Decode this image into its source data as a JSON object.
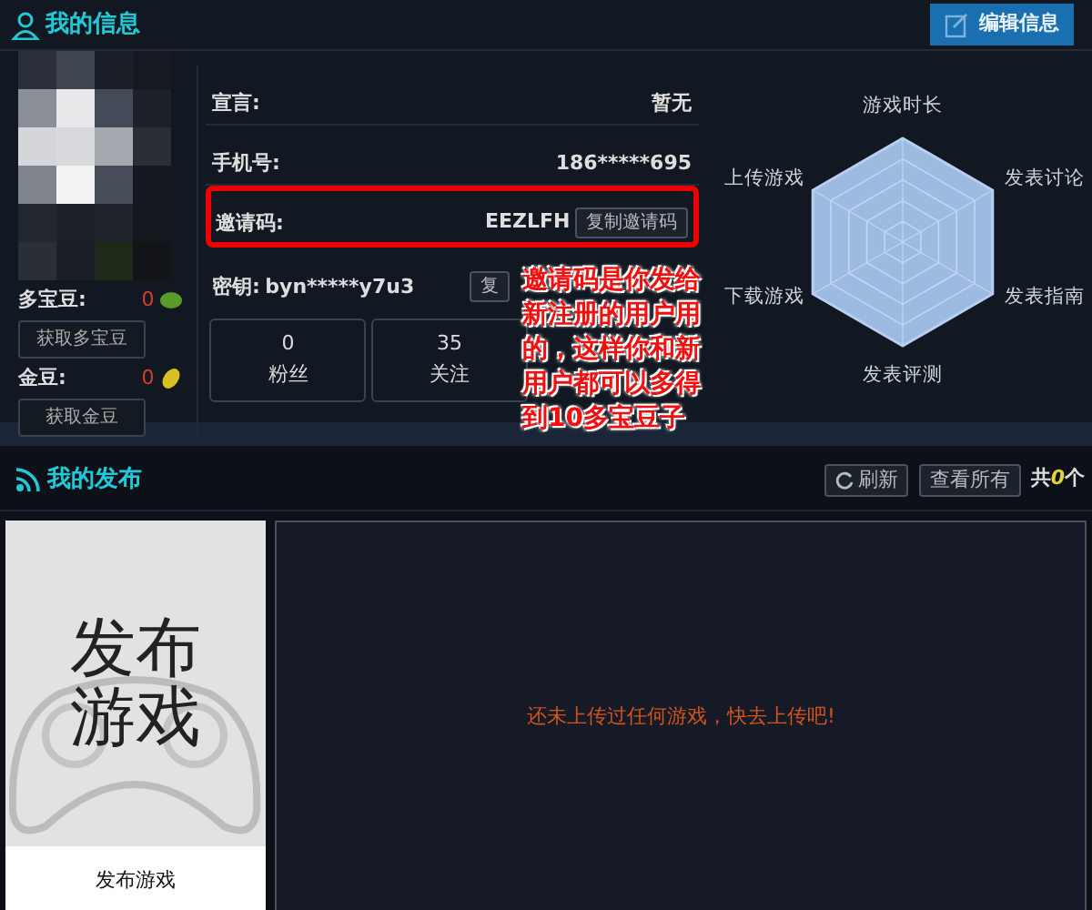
{
  "profile": {
    "title": "我的信息",
    "edit_button": "编辑信息"
  },
  "wallet": [
    {
      "kind": "bean",
      "label": "多宝豆:",
      "value": "0",
      "button": "获取多宝豆"
    },
    {
      "kind": "gold",
      "label": "金豆:",
      "value": "0",
      "button": "获取金豆"
    }
  ],
  "fields": [
    {
      "kind": "split",
      "label": "宣言:",
      "value": "暂无",
      "highlighted": false
    },
    {
      "kind": "split",
      "label": "手机号:",
      "value": "186*****695",
      "highlighted": false
    },
    {
      "kind": "split",
      "label": "邀请码:",
      "value": "EEZLFH",
      "button": "复制邀请码",
      "highlighted": true
    },
    {
      "kind": "inline",
      "label": "密钥:",
      "value": "byn*****y7u3",
      "button": "复",
      "highlighted": false
    }
  ],
  "stats": [
    {
      "value": "0",
      "label": "粉丝"
    },
    {
      "value": "35",
      "label": "关注"
    }
  ],
  "radar": {
    "axes": [
      "游戏时长",
      "发表讨论",
      "发表指南",
      "发表评测",
      "下载游戏",
      "上传游戏"
    ]
  },
  "annotation": "邀请码是你发给新注册的用户用的，这样你和新用户都可以多得到10多宝豆子",
  "publish": {
    "title": "我的发布",
    "buttons": [
      {
        "kind": "refresh",
        "label": "刷新"
      },
      {
        "kind": "plain",
        "label": "查看所有"
      }
    ],
    "count_prefix": "共",
    "count": "0",
    "count_suffix": "个",
    "card_art_text": "发布游戏",
    "card_label": "发布游戏",
    "empty_message": "还未上传过任何游戏，快去上传吧!"
  }
}
